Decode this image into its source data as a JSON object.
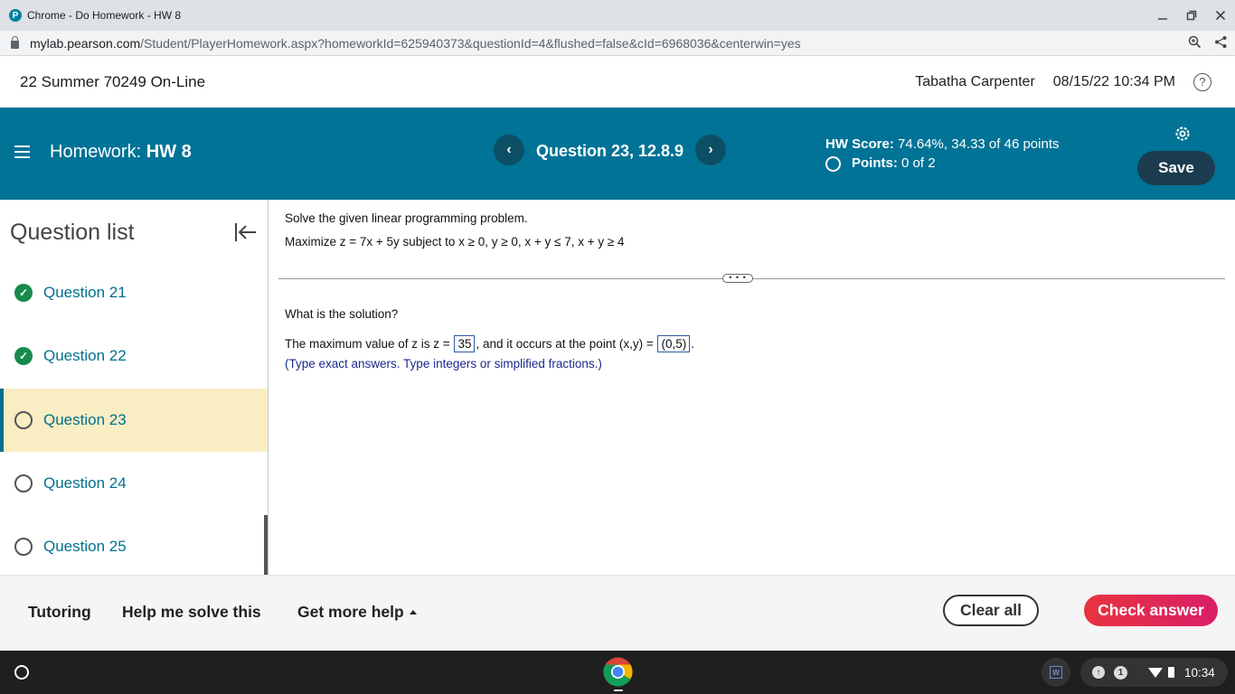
{
  "window": {
    "title": "Chrome - Do Homework - HW 8",
    "favicon_letter": "P"
  },
  "addressbar": {
    "host": "mylab.pearson.com",
    "path": "/Student/PlayerHomework.aspx?homeworkId=625940373&questionId=4&flushed=false&cId=6968036&centerwin=yes"
  },
  "header": {
    "course": "22 Summer 70249 On-Line",
    "user": "Tabatha Carpenter",
    "datetime": "08/15/22 10:34 PM",
    "help_glyph": "?"
  },
  "hwbar": {
    "label": "Homework:",
    "hw_name": "HW 8",
    "question_title": "Question 23, 12.8.9",
    "prev_glyph": "‹",
    "next_glyph": "›",
    "score_label": "HW Score:",
    "score_value": "74.64%, 34.33 of 46 points",
    "points_label": "Points:",
    "points_value": "0 of 2",
    "save_label": "Save"
  },
  "sidebar": {
    "title": "Question list",
    "items": [
      {
        "label": "Question 21",
        "status": "done"
      },
      {
        "label": "Question 22",
        "status": "done"
      },
      {
        "label": "Question 23",
        "status": "current"
      },
      {
        "label": "Question 24",
        "status": "open"
      },
      {
        "label": "Question 25",
        "status": "open"
      }
    ]
  },
  "question": {
    "instruction": "Solve the given linear programming problem.",
    "problem": "Maximize z = 7x + 5y subject to x ≥ 0, y ≥ 0, x + y ≤ 7, x + y ≥ 4",
    "divider_handle": "• • •",
    "prompt": "What is the solution?",
    "answer_prefix": "The maximum value of z is z =",
    "answer_z": "35",
    "answer_middle": ", and it occurs at the point (x,y) =",
    "answer_point": "(0,5)",
    "answer_suffix": ".",
    "hint": "(Type exact answers.  Type integers or simplified fractions.)"
  },
  "footer": {
    "tutoring": "Tutoring",
    "help_solve": "Help me solve this",
    "more_help": "Get more help",
    "clear_all": "Clear all",
    "check_answer": "Check answer"
  },
  "taskbar": {
    "w_icon": "W",
    "notif_count": "1",
    "time": "10:34"
  },
  "colors": {
    "hw_bar": "#007396",
    "save_button": "#1c3b4e",
    "current_item_bg": "#f8edc3",
    "check_answer": "#e2334a",
    "done_check": "#178a4c",
    "link_text": "#00708f"
  },
  "icons": [
    "hamburger-icon",
    "chevron-left-icon",
    "chevron-right-icon",
    "gear-icon",
    "collapse-panel-icon",
    "check-circle-icon",
    "empty-circle-icon",
    "help-icon",
    "zoom-icon",
    "share-icon",
    "lock-icon",
    "chrome-icon",
    "wifi-icon",
    "battery-icon"
  ]
}
